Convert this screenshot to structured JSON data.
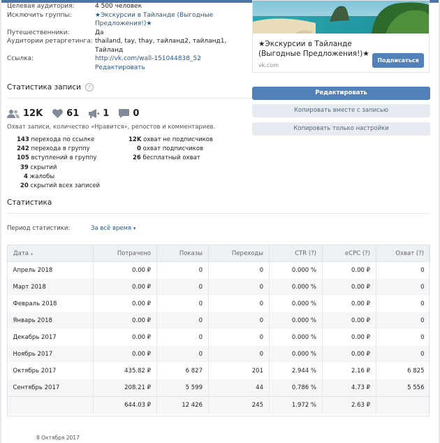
{
  "info": {
    "rows": [
      {
        "label": "Целевая аудитория:",
        "value": "4 500 человек"
      },
      {
        "label": "Исключить группы:",
        "value": "★Экскурсии в Тайланде (Выгодные Предложения!)★"
      },
      {
        "label": "Путешественники:",
        "value": "Да"
      },
      {
        "label": "Аудитории ретаргетинга:",
        "value": "thailand, tay, thay, тайланд2, тайланд1, Тайланд"
      },
      {
        "label": "Ссылка:",
        "value": "http://vk.com/wall-151044838_52"
      }
    ],
    "edit_link": "Редактировать"
  },
  "post_stats": {
    "title": "Статистика записи",
    "hint": "?",
    "counters": {
      "reach": "12K",
      "likes": "61",
      "reposts": "1",
      "comments": "0"
    },
    "note": "Охват записи, количество «Нравится», репостов и комментариев.",
    "left": [
      {
        "n": "143",
        "t": "перехода по ссылке"
      },
      {
        "n": "242",
        "t": "перехода в группу"
      },
      {
        "n": "105",
        "t": "вступлений в группу"
      },
      {
        "n": "39",
        "t": "скрытий"
      },
      {
        "n": "4",
        "t": "жалобы"
      },
      {
        "n": "20",
        "t": "скрытий всех записей"
      }
    ],
    "right": [
      {
        "n": "12K",
        "t": "охват не подписчиков"
      },
      {
        "n": "0",
        "t": "охват подписчиков"
      },
      {
        "n": "26",
        "t": "бесплатный охват"
      }
    ]
  },
  "statistics": {
    "title": "Статистика",
    "period_label": "Период статистики:",
    "period_value": "За всё время"
  },
  "table": {
    "headers": [
      "Дата",
      "Потрачено",
      "Показы",
      "Переходы",
      "CTR (?)",
      "eCPC (?)",
      "Охват (?)"
    ],
    "rows": [
      [
        "Апрель 2018",
        "0.00 ₽",
        "0",
        "0",
        "0.000 %",
        "0.00 ₽",
        "0"
      ],
      [
        "Март 2018",
        "0.00 ₽",
        "0",
        "0",
        "0.000 %",
        "0.00 ₽",
        "0"
      ],
      [
        "Февраль 2018",
        "0.00 ₽",
        "0",
        "0",
        "0.000 %",
        "0.00 ₽",
        "0"
      ],
      [
        "Январь 2018",
        "0.00 ₽",
        "0",
        "0",
        "0.000 %",
        "0.00 ₽",
        "0"
      ],
      [
        "Декабрь 2017",
        "0.00 ₽",
        "0",
        "0",
        "0.000 %",
        "0.00 ₽",
        "0"
      ],
      [
        "Ноябрь 2017",
        "0.00 ₽",
        "0",
        "0",
        "0.000 %",
        "0.00 ₽",
        "0"
      ],
      [
        "Октябрь 2017",
        "435.82 ₽",
        "6 827",
        "201",
        "2.944 %",
        "2.16 ₽",
        "6 825"
      ],
      [
        "Сентябрь 2017",
        "208.21 ₽",
        "5 599",
        "44",
        "0.786 %",
        "4.73 ₽",
        "5 556"
      ]
    ],
    "total": [
      "",
      "644.03 ₽",
      "12 426",
      "245",
      "1.972 %",
      "2.63 ₽",
      ""
    ]
  },
  "footer_date": "8 Октября 2017",
  "ad": {
    "title": "★Экскурсии в Тайланде (Выгодные Предложения!)★",
    "domain": "vk.com",
    "subscribe": "Подписаться"
  },
  "actions": {
    "edit": "Редактировать",
    "copy_with_post": "Копировать вместе с записью",
    "copy_settings": "Копировать только настройки"
  },
  "colors": {
    "accent": "#5181b8",
    "link": "#2a5885",
    "secondary_btn": "#e5ebf1"
  }
}
